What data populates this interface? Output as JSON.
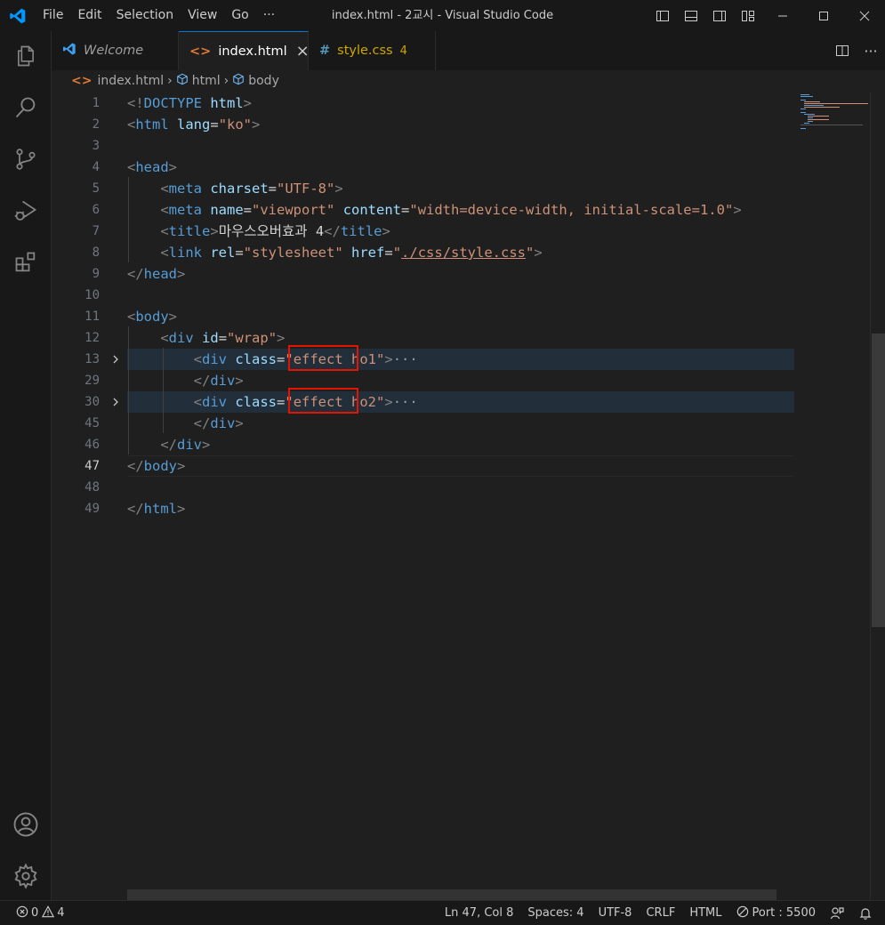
{
  "window": {
    "title": "index.html - 2교시 - Visual Studio Code"
  },
  "menu": [
    "File",
    "Edit",
    "Selection",
    "View",
    "Go",
    "···"
  ],
  "tabs": [
    {
      "label": "Welcome",
      "icon": "vscode-logo-icon"
    },
    {
      "label": "index.html",
      "icon": "html-file-icon",
      "close": "×"
    },
    {
      "label": "style.css",
      "icon": "css-file-icon",
      "badge": "4"
    }
  ],
  "breadcrumbs": [
    "index.html",
    "html",
    "body"
  ],
  "editor": {
    "lines": [
      {
        "n": "1",
        "html": "<span class='t-punc'>&lt;!</span><span class='t-doc'>DOCTYPE</span> <span class='t-attr'>html</span><span class='t-punc'>&gt;</span>"
      },
      {
        "n": "2",
        "html": "<span class='t-punc'>&lt;</span><span class='t-tag'>html</span> <span class='t-attr'>lang</span><span class='t-txt'>=</span><span class='t-str'>\"ko\"</span><span class='t-punc'>&gt;</span>"
      },
      {
        "n": "3",
        "html": ""
      },
      {
        "n": "4",
        "html": "<span class='t-punc'>&lt;</span><span class='t-tag'>head</span><span class='t-punc'>&gt;</span>"
      },
      {
        "n": "5",
        "html": "    <span class='t-punc'>&lt;</span><span class='t-tag'>meta</span> <span class='t-attr'>charset</span><span class='t-txt'>=</span><span class='t-str'>\"UTF-8\"</span><span class='t-punc'>&gt;</span>"
      },
      {
        "n": "6",
        "html": "    <span class='t-punc'>&lt;</span><span class='t-tag'>meta</span> <span class='t-attr'>name</span><span class='t-txt'>=</span><span class='t-str'>\"viewport\"</span> <span class='t-attr'>content</span><span class='t-txt'>=</span><span class='t-str'>\"width=device-width, initial-scale=1.0\"</span><span class='t-punc'>&gt;</span>"
      },
      {
        "n": "7",
        "html": "    <span class='t-punc'>&lt;</span><span class='t-tag'>title</span><span class='t-punc'>&gt;</span><span class='t-txt'>마우스오버효과 4</span><span class='t-punc'>&lt;/</span><span class='t-tag'>title</span><span class='t-punc'>&gt;</span>"
      },
      {
        "n": "8",
        "html": "    <span class='t-punc'>&lt;</span><span class='t-tag'>link</span> <span class='t-attr'>rel</span><span class='t-txt'>=</span><span class='t-str'>\"stylesheet\"</span> <span class='t-attr'>href</span><span class='t-txt'>=</span><span class='t-str'>\"<span class='underline'>./css/style.css</span>\"</span><span class='t-punc'>&gt;</span>"
      },
      {
        "n": "9",
        "html": "<span class='t-punc'>&lt;/</span><span class='t-tag'>head</span><span class='t-punc'>&gt;</span>"
      },
      {
        "n": "10",
        "html": ""
      },
      {
        "n": "11",
        "html": "<span class='t-punc'>&lt;</span><span class='t-tag'>body</span><span class='t-punc'>&gt;</span>"
      },
      {
        "n": "12",
        "html": "    <span class='t-punc'>&lt;</span><span class='t-tag'>div</span> <span class='t-attr'>id</span><span class='t-txt'>=</span><span class='t-str'>\"wrap\"</span><span class='t-punc'>&gt;</span>"
      },
      {
        "n": "13",
        "html": "        <span class='t-punc'>&lt;</span><span class='t-tag'>div</span> <span class='t-attr'>class</span><span class='t-txt'>=</span><span class='t-str'>\"effect ho1\"</span><span class='t-punc'>&gt;</span><span class='t-ell'>···</span>",
        "fold": true,
        "hl": true
      },
      {
        "n": "29",
        "html": "        <span class='t-punc'>&lt;/</span><span class='t-tag'>div</span><span class='t-punc'>&gt;</span>"
      },
      {
        "n": "30",
        "html": "        <span class='t-punc'>&lt;</span><span class='t-tag'>div</span> <span class='t-attr'>class</span><span class='t-txt'>=</span><span class='t-str'>\"effect ho2\"</span><span class='t-punc'>&gt;</span><span class='t-ell'>···</span>",
        "fold": true,
        "hl": true
      },
      {
        "n": "45",
        "html": "        <span class='t-punc'>&lt;/</span><span class='t-tag'>div</span><span class='t-punc'>&gt;</span>"
      },
      {
        "n": "46",
        "html": "    <span class='t-punc'>&lt;/</span><span class='t-tag'>div</span><span class='t-punc'>&gt;</span>"
      },
      {
        "n": "47",
        "html": "<span class='t-punc'>&lt;/</span><span class='t-tag'>body</span><span class='t-punc'>&gt;</span>",
        "current": true
      },
      {
        "n": "48",
        "html": ""
      },
      {
        "n": "49",
        "html": "<span class='t-punc'>&lt;/</span><span class='t-tag'>html</span><span class='t-punc'>&gt;</span>"
      }
    ]
  },
  "statusbar": {
    "errors": "0",
    "warnings": "4",
    "position": "Ln 47, Col 8",
    "spaces": "Spaces: 4",
    "encoding": "UTF-8",
    "eol": "CRLF",
    "language": "HTML",
    "port": "Port : 5500"
  },
  "colors": {
    "accent": "#0078d4",
    "highlight_box": "#e51400",
    "tag": "#569cd6",
    "attr": "#9cdcfe",
    "string": "#ce9178"
  }
}
